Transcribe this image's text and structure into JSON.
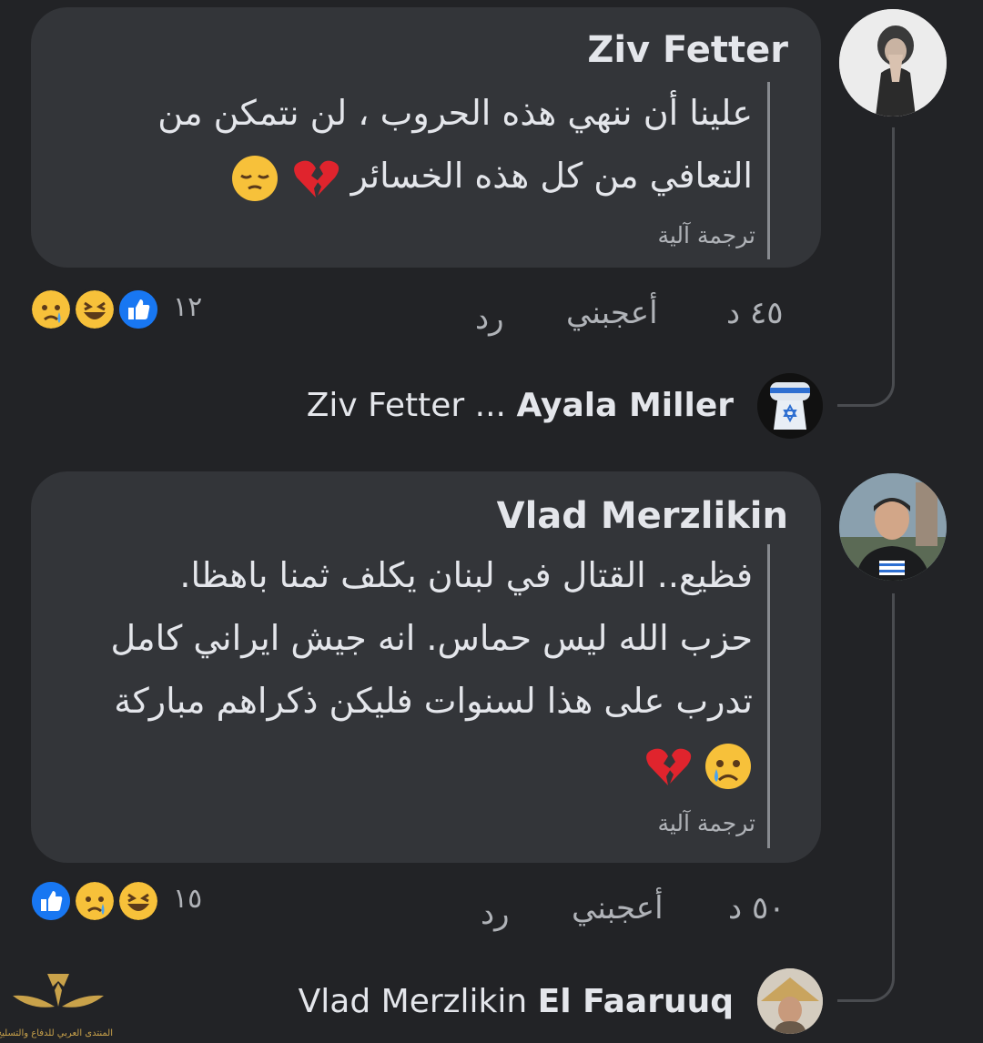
{
  "comments": [
    {
      "author": "Ziv Fetter",
      "text_lines": [
        "علينا أن ننهي هذه الحروب ، لن نتمكن من",
        "التعافي من كل هذه الخسائر"
      ],
      "translate_label": "ترجمة آلية",
      "time": "٤٥ د",
      "like_label": "أعجبني",
      "reply_label": "رد",
      "reaction_count": "١٢",
      "reactions": [
        "sad-icon",
        "laugh-icon",
        "like-icon"
      ],
      "reply_preview": {
        "name": "Ayala Miller",
        "text": "Ziv Fetter ..."
      }
    },
    {
      "author": "Vlad Merzlikin",
      "text_lines": [
        "فظيع.. القتال في لبنان يكلف ثمنا باهظا.",
        "حزب الله ليس حماس. انه جيش ايراني كامل",
        "تدرب على هذا لسنوات فليكن ذكراهم مباركة"
      ],
      "translate_label": "ترجمة آلية",
      "time": "٥٠ د",
      "like_label": "أعجبني",
      "reply_label": "رد",
      "reaction_count": "١٥",
      "reactions": [
        "like-icon",
        "sad-icon",
        "laugh-icon"
      ],
      "reply_preview": {
        "name": "El Faaruuq",
        "text": "Vlad Merzlikin"
      }
    }
  ],
  "watermark": {
    "text": "المنتدى العربي للدفاع والتسليح"
  },
  "colors": {
    "background": "#222326",
    "bubble": "#333539",
    "like_blue": "#1877f2"
  }
}
